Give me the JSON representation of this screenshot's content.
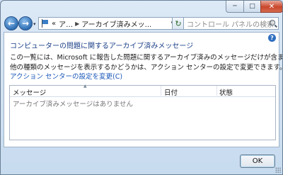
{
  "window": {
    "controls": {
      "minimize": "─",
      "maximize": "□",
      "close": "✕"
    }
  },
  "toolbar": {
    "back_symbol": "←",
    "forward_symbol": "→",
    "dropdown_symbol": "▾",
    "address": {
      "overflow": "«",
      "crumb_1": "ア…",
      "separator": "▶",
      "crumb_2": "アーカイブ済みメッ..."
    },
    "refresh_symbol": "↻",
    "search_placeholder": "コントロール パネルの検索"
  },
  "content": {
    "help_symbol": "?",
    "title": "コンピューターの問題に関するアーカイブ済みメッセージ",
    "description_line1": "この一覧には、Microsoft に報告した問題に関するアーカイブ済みのメッセージだけが含まれています。",
    "description_line2": "他の種類のメッセージを表示するかどうかは、アクション センターの設定で変更できます。",
    "settings_link": "アクション センターの設定を変更(C)",
    "list": {
      "columns": [
        "メッセージ",
        "日付",
        "状態"
      ],
      "sort_indicator": "▲",
      "empty_text": "アーカイブ済みメッセージはありません"
    }
  },
  "footer": {
    "ok_label": "OK"
  }
}
